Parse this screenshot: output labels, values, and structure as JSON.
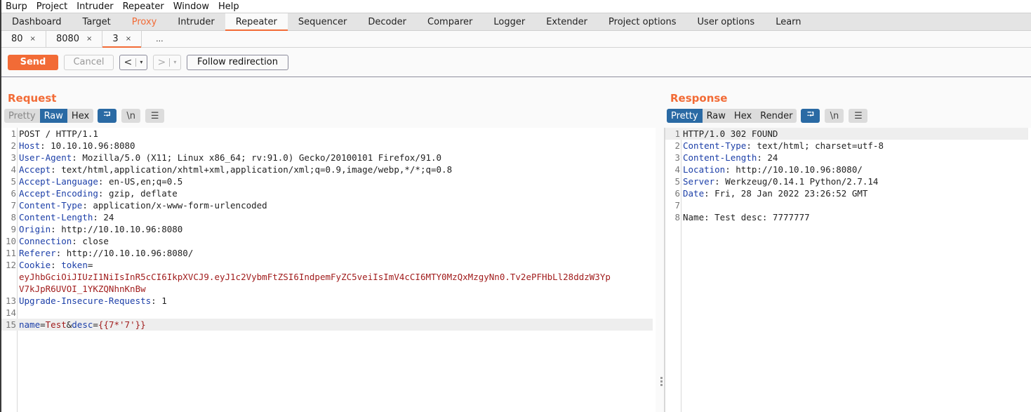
{
  "menubar": [
    "Burp",
    "Project",
    "Intruder",
    "Repeater",
    "Window",
    "Help"
  ],
  "main_tabs": [
    {
      "label": "Dashboard",
      "state": "normal"
    },
    {
      "label": "Target",
      "state": "normal"
    },
    {
      "label": "Proxy",
      "state": "highlighted"
    },
    {
      "label": "Intruder",
      "state": "normal"
    },
    {
      "label": "Repeater",
      "state": "active"
    },
    {
      "label": "Sequencer",
      "state": "normal"
    },
    {
      "label": "Decoder",
      "state": "normal"
    },
    {
      "label": "Comparer",
      "state": "normal"
    },
    {
      "label": "Logger",
      "state": "normal"
    },
    {
      "label": "Extender",
      "state": "normal"
    },
    {
      "label": "Project options",
      "state": "normal"
    },
    {
      "label": "User options",
      "state": "normal"
    },
    {
      "label": "Learn",
      "state": "normal"
    }
  ],
  "repeater_tabs": [
    {
      "label": "80",
      "close": "×",
      "active": false
    },
    {
      "label": "8080",
      "close": "×",
      "active": false
    },
    {
      "label": "3",
      "close": "×",
      "active": true
    }
  ],
  "repeater_more": "...",
  "toolbar": {
    "send": "Send",
    "cancel": "Cancel",
    "back": "<",
    "forward": ">",
    "dropdown": "▾",
    "follow": "Follow redirection"
  },
  "colors": {
    "accent": "#f26b36",
    "selected_view": "#2a6aa4",
    "header_key": "#1c3fa8",
    "value_red": "#a11d1d"
  },
  "request": {
    "title": "Request",
    "views": [
      {
        "label": "Pretty",
        "state": "disabled"
      },
      {
        "label": "Raw",
        "state": "on"
      },
      {
        "label": "Hex",
        "state": "off"
      }
    ],
    "icons": {
      "wrap": "⮒",
      "newline": "\\n",
      "menu": "☰"
    },
    "lines": [
      {
        "n": "1",
        "parts": [
          {
            "t": "POST / HTTP/1.1",
            "c": ""
          }
        ]
      },
      {
        "n": "2",
        "parts": [
          {
            "t": "Host",
            "c": "k"
          },
          {
            "t": ": 10.10.10.96:8080",
            "c": ""
          }
        ]
      },
      {
        "n": "3",
        "parts": [
          {
            "t": "User-Agent",
            "c": "k"
          },
          {
            "t": ": Mozilla/5.0 (X11; Linux x86_64; rv:91.0) Gecko/20100101 Firefox/91.0",
            "c": ""
          }
        ]
      },
      {
        "n": "4",
        "parts": [
          {
            "t": "Accept",
            "c": "k"
          },
          {
            "t": ": text/html,application/xhtml+xml,application/xml;q=0.9,image/webp,*/*;q=0.8",
            "c": ""
          }
        ]
      },
      {
        "n": "5",
        "parts": [
          {
            "t": "Accept-Language",
            "c": "k"
          },
          {
            "t": ": en-US,en;q=0.5",
            "c": ""
          }
        ]
      },
      {
        "n": "6",
        "parts": [
          {
            "t": "Accept-Encoding",
            "c": "k"
          },
          {
            "t": ": gzip, deflate",
            "c": ""
          }
        ]
      },
      {
        "n": "7",
        "parts": [
          {
            "t": "Content-Type",
            "c": "k"
          },
          {
            "t": ": application/x-www-form-urlencoded",
            "c": ""
          }
        ]
      },
      {
        "n": "8",
        "parts": [
          {
            "t": "Content-Length",
            "c": "k"
          },
          {
            "t": ": 24",
            "c": ""
          }
        ]
      },
      {
        "n": "9",
        "parts": [
          {
            "t": "Origin",
            "c": "k"
          },
          {
            "t": ": http://10.10.10.96:8080",
            "c": ""
          }
        ]
      },
      {
        "n": "10",
        "parts": [
          {
            "t": "Connection",
            "c": "k"
          },
          {
            "t": ": close",
            "c": ""
          }
        ]
      },
      {
        "n": "11",
        "parts": [
          {
            "t": "Referer",
            "c": "k"
          },
          {
            "t": ": http://10.10.10.96:8080/",
            "c": ""
          }
        ]
      },
      {
        "n": "12",
        "parts": [
          {
            "t": "Cookie",
            "c": "k"
          },
          {
            "t": ": ",
            "c": ""
          },
          {
            "t": "token",
            "c": "k"
          },
          {
            "t": "=",
            "c": ""
          }
        ]
      },
      {
        "n": "",
        "parts": [
          {
            "t": "eyJhbGciOiJIUzI1NiIsInR5cCI6IkpXVCJ9.eyJ1c2VybmFtZSI6IndpemFyZC5veiIsImV4cCI6MTY0MzQxMzgyNn0.Tv2ePFHbLl28ddzW3Yp",
            "c": "v-red"
          }
        ]
      },
      {
        "n": "",
        "parts": [
          {
            "t": "V7kJpR6UVOI_1YKZQNhnKnBw",
            "c": "v-red"
          }
        ]
      },
      {
        "n": "13",
        "parts": [
          {
            "t": "Upgrade-Insecure-Requests",
            "c": "k"
          },
          {
            "t": ": 1",
            "c": ""
          }
        ]
      },
      {
        "n": "14",
        "parts": [
          {
            "t": "",
            "c": ""
          }
        ]
      },
      {
        "n": "15",
        "parts": [
          {
            "t": "name",
            "c": "k"
          },
          {
            "t": "=",
            "c": ""
          },
          {
            "t": "Test",
            "c": "v-red"
          },
          {
            "t": "&",
            "c": ""
          },
          {
            "t": "desc",
            "c": "k"
          },
          {
            "t": "=",
            "c": ""
          },
          {
            "t": "{{7*'7'}}",
            "c": "v-red"
          }
        ],
        "highlight": true
      }
    ]
  },
  "response": {
    "title": "Response",
    "views": [
      {
        "label": "Pretty",
        "state": "on"
      },
      {
        "label": "Raw",
        "state": "off"
      },
      {
        "label": "Hex",
        "state": "off"
      },
      {
        "label": "Render",
        "state": "off"
      }
    ],
    "icons": {
      "wrap": "⮒",
      "newline": "\\n",
      "menu": "☰"
    },
    "lines": [
      {
        "n": "1",
        "parts": [
          {
            "t": "HTTP/1.0 302 FOUND",
            "c": ""
          }
        ],
        "highlight": true
      },
      {
        "n": "2",
        "parts": [
          {
            "t": "Content-Type",
            "c": "k"
          },
          {
            "t": ": text/html; charset=utf-8",
            "c": ""
          }
        ]
      },
      {
        "n": "3",
        "parts": [
          {
            "t": "Content-Length",
            "c": "k"
          },
          {
            "t": ": 24",
            "c": ""
          }
        ]
      },
      {
        "n": "4",
        "parts": [
          {
            "t": "Location",
            "c": "k"
          },
          {
            "t": ": http://10.10.10.96:8080/",
            "c": ""
          }
        ]
      },
      {
        "n": "5",
        "parts": [
          {
            "t": "Server",
            "c": "k"
          },
          {
            "t": ": Werkzeug/0.14.1 Python/2.7.14",
            "c": ""
          }
        ]
      },
      {
        "n": "6",
        "parts": [
          {
            "t": "Date",
            "c": "k"
          },
          {
            "t": ": Fri, 28 Jan 2022 23:26:52 GMT",
            "c": ""
          }
        ]
      },
      {
        "n": "7",
        "parts": [
          {
            "t": "",
            "c": ""
          }
        ]
      },
      {
        "n": "8",
        "parts": [
          {
            "t": "Name: Test desc: 7777777",
            "c": ""
          }
        ]
      }
    ]
  }
}
